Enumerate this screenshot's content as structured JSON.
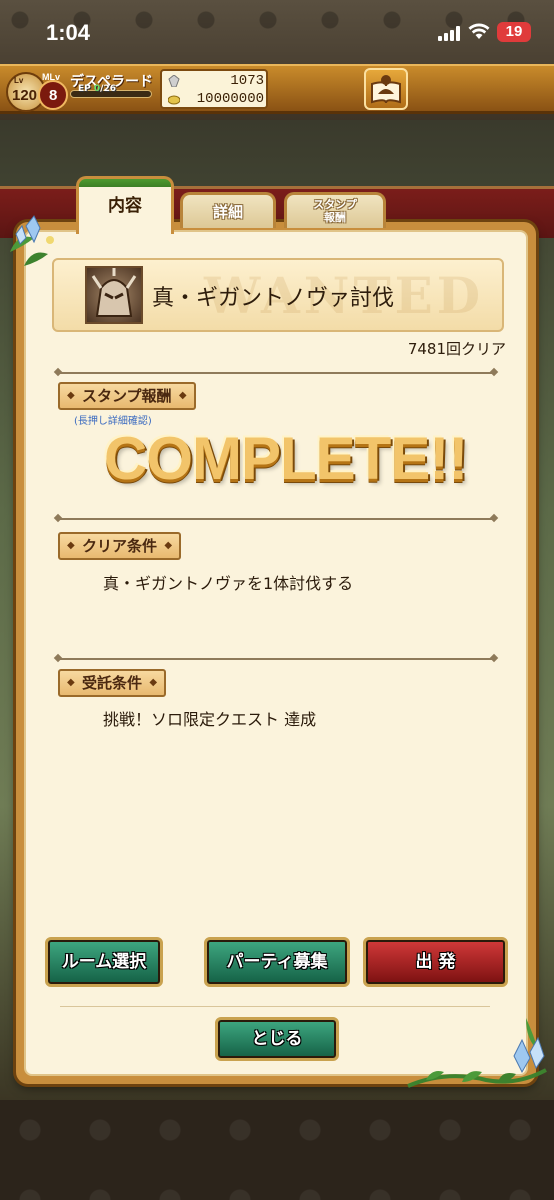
{
  "status_bar": {
    "time": "1:04",
    "battery": "19"
  },
  "header": {
    "lv_label": "Lv",
    "level": "120",
    "mlv_label": "MLv",
    "master_level": "8",
    "player_name": "デスペラード",
    "ep_label": "EP",
    "ep_current": "0",
    "ep_max": "/26",
    "ep_progress": 0.0,
    "currency_1": "1073",
    "currency_2": "10000000",
    "book_icon": "book-person-icon"
  },
  "tabs": {
    "content": "内容",
    "detail": "詳細",
    "stamp_line1": "スタンプ",
    "stamp_line2": "報酬"
  },
  "quest": {
    "watermark": "WANTED",
    "title": "真・ギガントノヴァ討伐",
    "clear_count": "7481回クリア"
  },
  "sections": {
    "stamp_reward": {
      "label": "スタンプ報酬",
      "hint": "(長押し詳細確認)",
      "status": "COMPLETE!!"
    },
    "clear_condition": {
      "label": "クリア条件",
      "text": "真・ギガントノヴァを1体討伐する"
    },
    "accept_condition": {
      "label": "受託条件",
      "text": "挑戦！ソロ限定クエスト 達成"
    }
  },
  "buttons": {
    "room_select": "ルーム選択",
    "party_recruit": "パーティ募集",
    "depart": "出 発",
    "close": "とじる"
  },
  "colors": {
    "panel_frame": "#c88e3d",
    "panel_bg": "#fbf3dc",
    "button_green": "#146045",
    "button_red": "#7a1010",
    "complete_gold": "#f2c46a"
  }
}
